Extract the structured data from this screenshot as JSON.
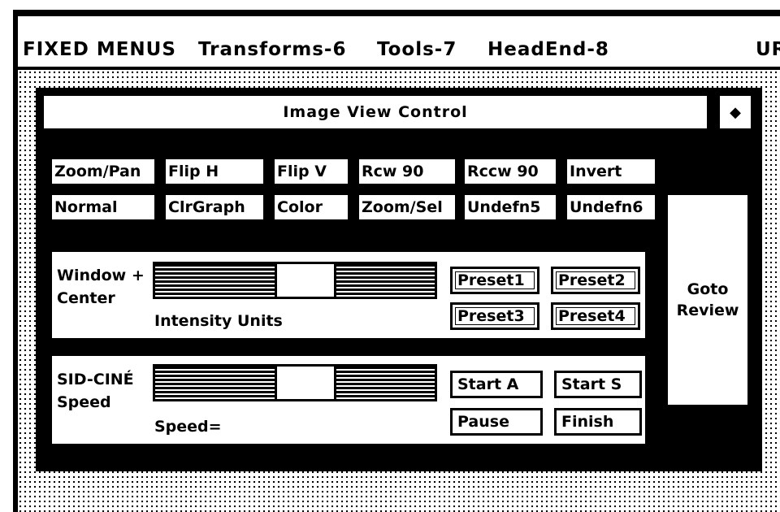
{
  "menubar": {
    "items": [
      "FIXED MENUS",
      "Transforms-6",
      "Tools-7",
      "HeadEnd-8"
    ],
    "right_label": "UR"
  },
  "window": {
    "title": "Image View Control",
    "close_glyph": "◆"
  },
  "tools": {
    "row1": [
      "Zoom/Pan",
      "Flip H",
      "Flip V",
      "Rcw 90",
      "Rccw 90",
      "Invert"
    ],
    "row2": [
      "Normal",
      "ClrGraph",
      "Color",
      "Zoom/Sel",
      "Undefn5",
      "Undefn6"
    ]
  },
  "goto_button": {
    "line1": "Goto",
    "line2": "Review"
  },
  "window_center": {
    "label_line1": "Window +",
    "label_line2": "Center",
    "slider_caption": "Intensity Units",
    "slider_value": 0.55,
    "presets": [
      "Preset1",
      "Preset2",
      "Preset3",
      "Preset4"
    ]
  },
  "cine": {
    "label_line1": "SID-CINÉ",
    "label_line2": "Speed",
    "slider_caption": "Speed=",
    "slider_value": 0.55,
    "buttons": [
      "Start A",
      "Start S",
      "Pause",
      "Finish"
    ]
  }
}
